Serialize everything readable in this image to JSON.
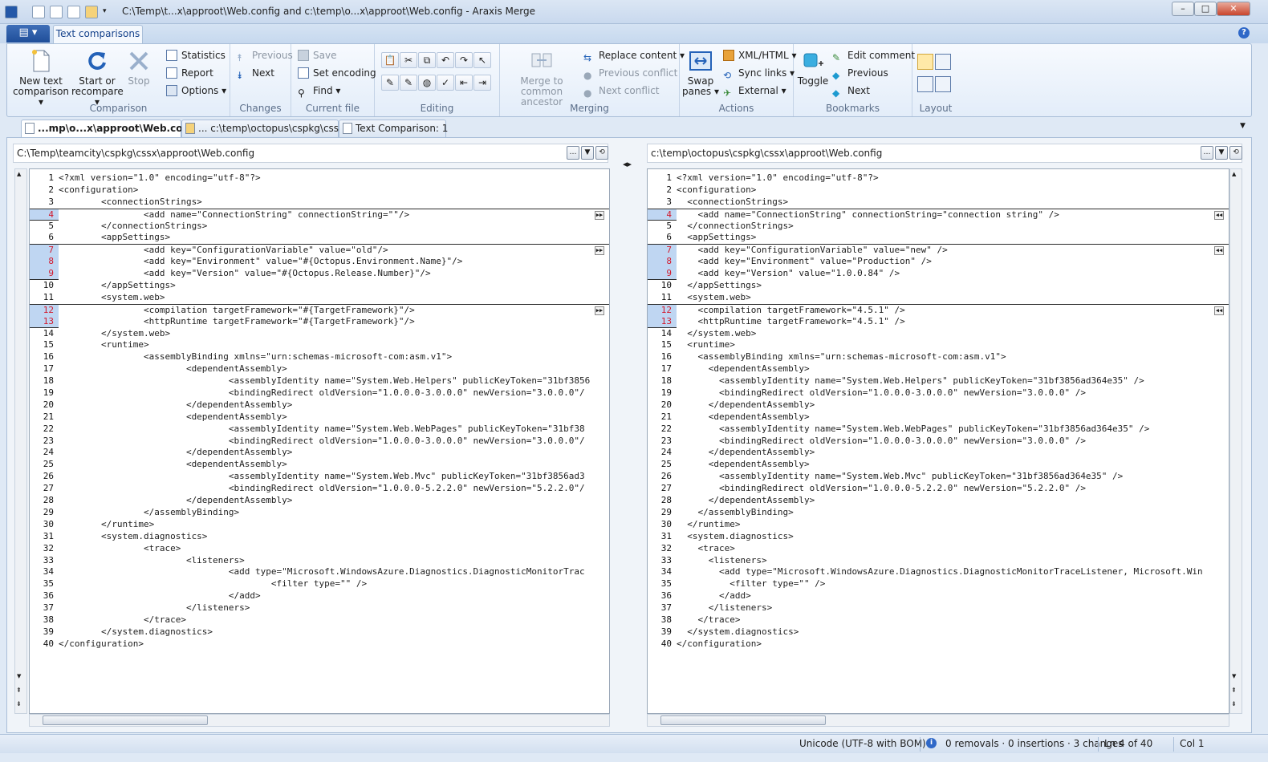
{
  "window": {
    "title": "C:\\Temp\\t...x\\approot\\Web.config and c:\\temp\\o...x\\approot\\Web.config - Araxis Merge",
    "controls": [
      "–",
      "□",
      "✕"
    ]
  },
  "ribbon": {
    "tab": "Text comparisons",
    "help": "?",
    "groups": {
      "comparison": {
        "label": "Comparison",
        "new_text_comparison": "New text comparison",
        "start_or_recompare": "Start or recompare",
        "stop": "Stop",
        "statistics": "Statistics",
        "report": "Report",
        "options": "Options"
      },
      "changes": {
        "label": "Changes",
        "previous": "Previous",
        "next": "Next"
      },
      "current_file": {
        "label": "Current file",
        "save": "Save",
        "set_encoding": "Set encoding",
        "find": "Find"
      },
      "editing": {
        "label": "Editing"
      },
      "merging": {
        "label": "Merging",
        "merge_to_common_ancestor": "Merge to common ancestor",
        "replace_content": "Replace content",
        "previous_conflict": "Previous conflict",
        "next_conflict": "Next conflict"
      },
      "actions": {
        "label": "Actions",
        "swap_panes": "Swap panes",
        "xml_html": "XML/HTML",
        "sync_links": "Sync links",
        "external": "External"
      },
      "bookmarks": {
        "label": "Bookmarks",
        "toggle": "Toggle",
        "edit_comment": "Edit comment",
        "previous": "Previous",
        "next": "Next"
      },
      "layout": {
        "label": "Layout"
      }
    }
  },
  "doc_tabs": [
    {
      "label": "...mp\\o...x\\approot\\Web.config",
      "active": true
    },
    {
      "label": "... c:\\temp\\octopus\\cspkg\\cssx",
      "active": false
    },
    {
      "label": "Text Comparison: 1",
      "active": false
    }
  ],
  "left_pane": {
    "path": "C:\\Temp\\teamcity\\cspkg\\cssx\\approot\\Web.config",
    "lines": [
      "<?xml version=\"1.0\" encoding=\"utf-8\"?>",
      "<configuration>",
      "        <connectionStrings>",
      "                <add name=\"ConnectionString\" connectionString=\"\"/>",
      "        </connectionStrings>",
      "        <appSettings>",
      "                <add key=\"ConfigurationVariable\" value=\"old\"/>",
      "                <add key=\"Environment\" value=\"#{Octopus.Environment.Name}\"/>",
      "                <add key=\"Version\" value=\"#{Octopus.Release.Number}\"/>",
      "        </appSettings>",
      "        <system.web>",
      "                <compilation targetFramework=\"#{TargetFramework}\"/>",
      "                <httpRuntime targetFramework=\"#{TargetFramework}\"/>",
      "        </system.web>",
      "        <runtime>",
      "                <assemblyBinding xmlns=\"urn:schemas-microsoft-com:asm.v1\">",
      "                        <dependentAssembly>",
      "                                <assemblyIdentity name=\"System.Web.Helpers\" publicKeyToken=\"31bf3856",
      "                                <bindingRedirect oldVersion=\"1.0.0.0-3.0.0.0\" newVersion=\"3.0.0.0\"/",
      "                        </dependentAssembly>",
      "                        <dependentAssembly>",
      "                                <assemblyIdentity name=\"System.Web.WebPages\" publicKeyToken=\"31bf38",
      "                                <bindingRedirect oldVersion=\"1.0.0.0-3.0.0.0\" newVersion=\"3.0.0.0\"/",
      "                        </dependentAssembly>",
      "                        <dependentAssembly>",
      "                                <assemblyIdentity name=\"System.Web.Mvc\" publicKeyToken=\"31bf3856ad3",
      "                                <bindingRedirect oldVersion=\"1.0.0.0-5.2.2.0\" newVersion=\"5.2.2.0\"/",
      "                        </dependentAssembly>",
      "                </assemblyBinding>",
      "        </runtime>",
      "        <system.diagnostics>",
      "                <trace>",
      "                        <listeners>",
      "                                <add type=\"Microsoft.WindowsAzure.Diagnostics.DiagnosticMonitorTrac",
      "                                        <filter type=\"\" />",
      "                                </add>",
      "                        </listeners>",
      "                </trace>",
      "        </system.diagnostics>",
      "</configuration>"
    ]
  },
  "right_pane": {
    "path": "c:\\temp\\octopus\\cspkg\\cssx\\approot\\Web.config",
    "lines": [
      "<?xml version=\"1.0\" encoding=\"utf-8\"?>",
      "<configuration>",
      "  <connectionStrings>",
      "    <add name=\"ConnectionString\" connectionString=\"connection string\" />",
      "  </connectionStrings>",
      "  <appSettings>",
      "    <add key=\"ConfigurationVariable\" value=\"new\" />",
      "    <add key=\"Environment\" value=\"Production\" />",
      "    <add key=\"Version\" value=\"1.0.0.84\" />",
      "  </appSettings>",
      "  <system.web>",
      "    <compilation targetFramework=\"4.5.1\" />",
      "    <httpRuntime targetFramework=\"4.5.1\" />",
      "  </system.web>",
      "  <runtime>",
      "    <assemblyBinding xmlns=\"urn:schemas-microsoft-com:asm.v1\">",
      "      <dependentAssembly>",
      "        <assemblyIdentity name=\"System.Web.Helpers\" publicKeyToken=\"31bf3856ad364e35\" />",
      "        <bindingRedirect oldVersion=\"1.0.0.0-3.0.0.0\" newVersion=\"3.0.0.0\" />",
      "      </dependentAssembly>",
      "      <dependentAssembly>",
      "        <assemblyIdentity name=\"System.Web.WebPages\" publicKeyToken=\"31bf3856ad364e35\" />",
      "        <bindingRedirect oldVersion=\"1.0.0.0-3.0.0.0\" newVersion=\"3.0.0.0\" />",
      "      </dependentAssembly>",
      "      <dependentAssembly>",
      "        <assemblyIdentity name=\"System.Web.Mvc\" publicKeyToken=\"31bf3856ad364e35\" />",
      "        <bindingRedirect oldVersion=\"1.0.0.0-5.2.2.0\" newVersion=\"5.2.2.0\" />",
      "      </dependentAssembly>",
      "    </assemblyBinding>",
      "  </runtime>",
      "  <system.diagnostics>",
      "    <trace>",
      "      <listeners>",
      "        <add type=\"Microsoft.WindowsAzure.Diagnostics.DiagnosticMonitorTraceListener, Microsoft.Win",
      "          <filter type=\"\" />",
      "        </add>",
      "      </listeners>",
      "    </trace>",
      "  </system.diagnostics>",
      "</configuration>"
    ]
  },
  "changed_lines": [
    4,
    7,
    8,
    9,
    12,
    13
  ],
  "status": {
    "encoding": "Unicode (UTF-8 with BOM)",
    "summary": "0 removals · 0 insertions · 3 changes",
    "position": "Ln 4 of 40",
    "column": "Col 1"
  },
  "colors": {
    "changed_line_bg": "#bfd6f2",
    "change_text": "#d2192d",
    "accent": "#1f4e99"
  }
}
